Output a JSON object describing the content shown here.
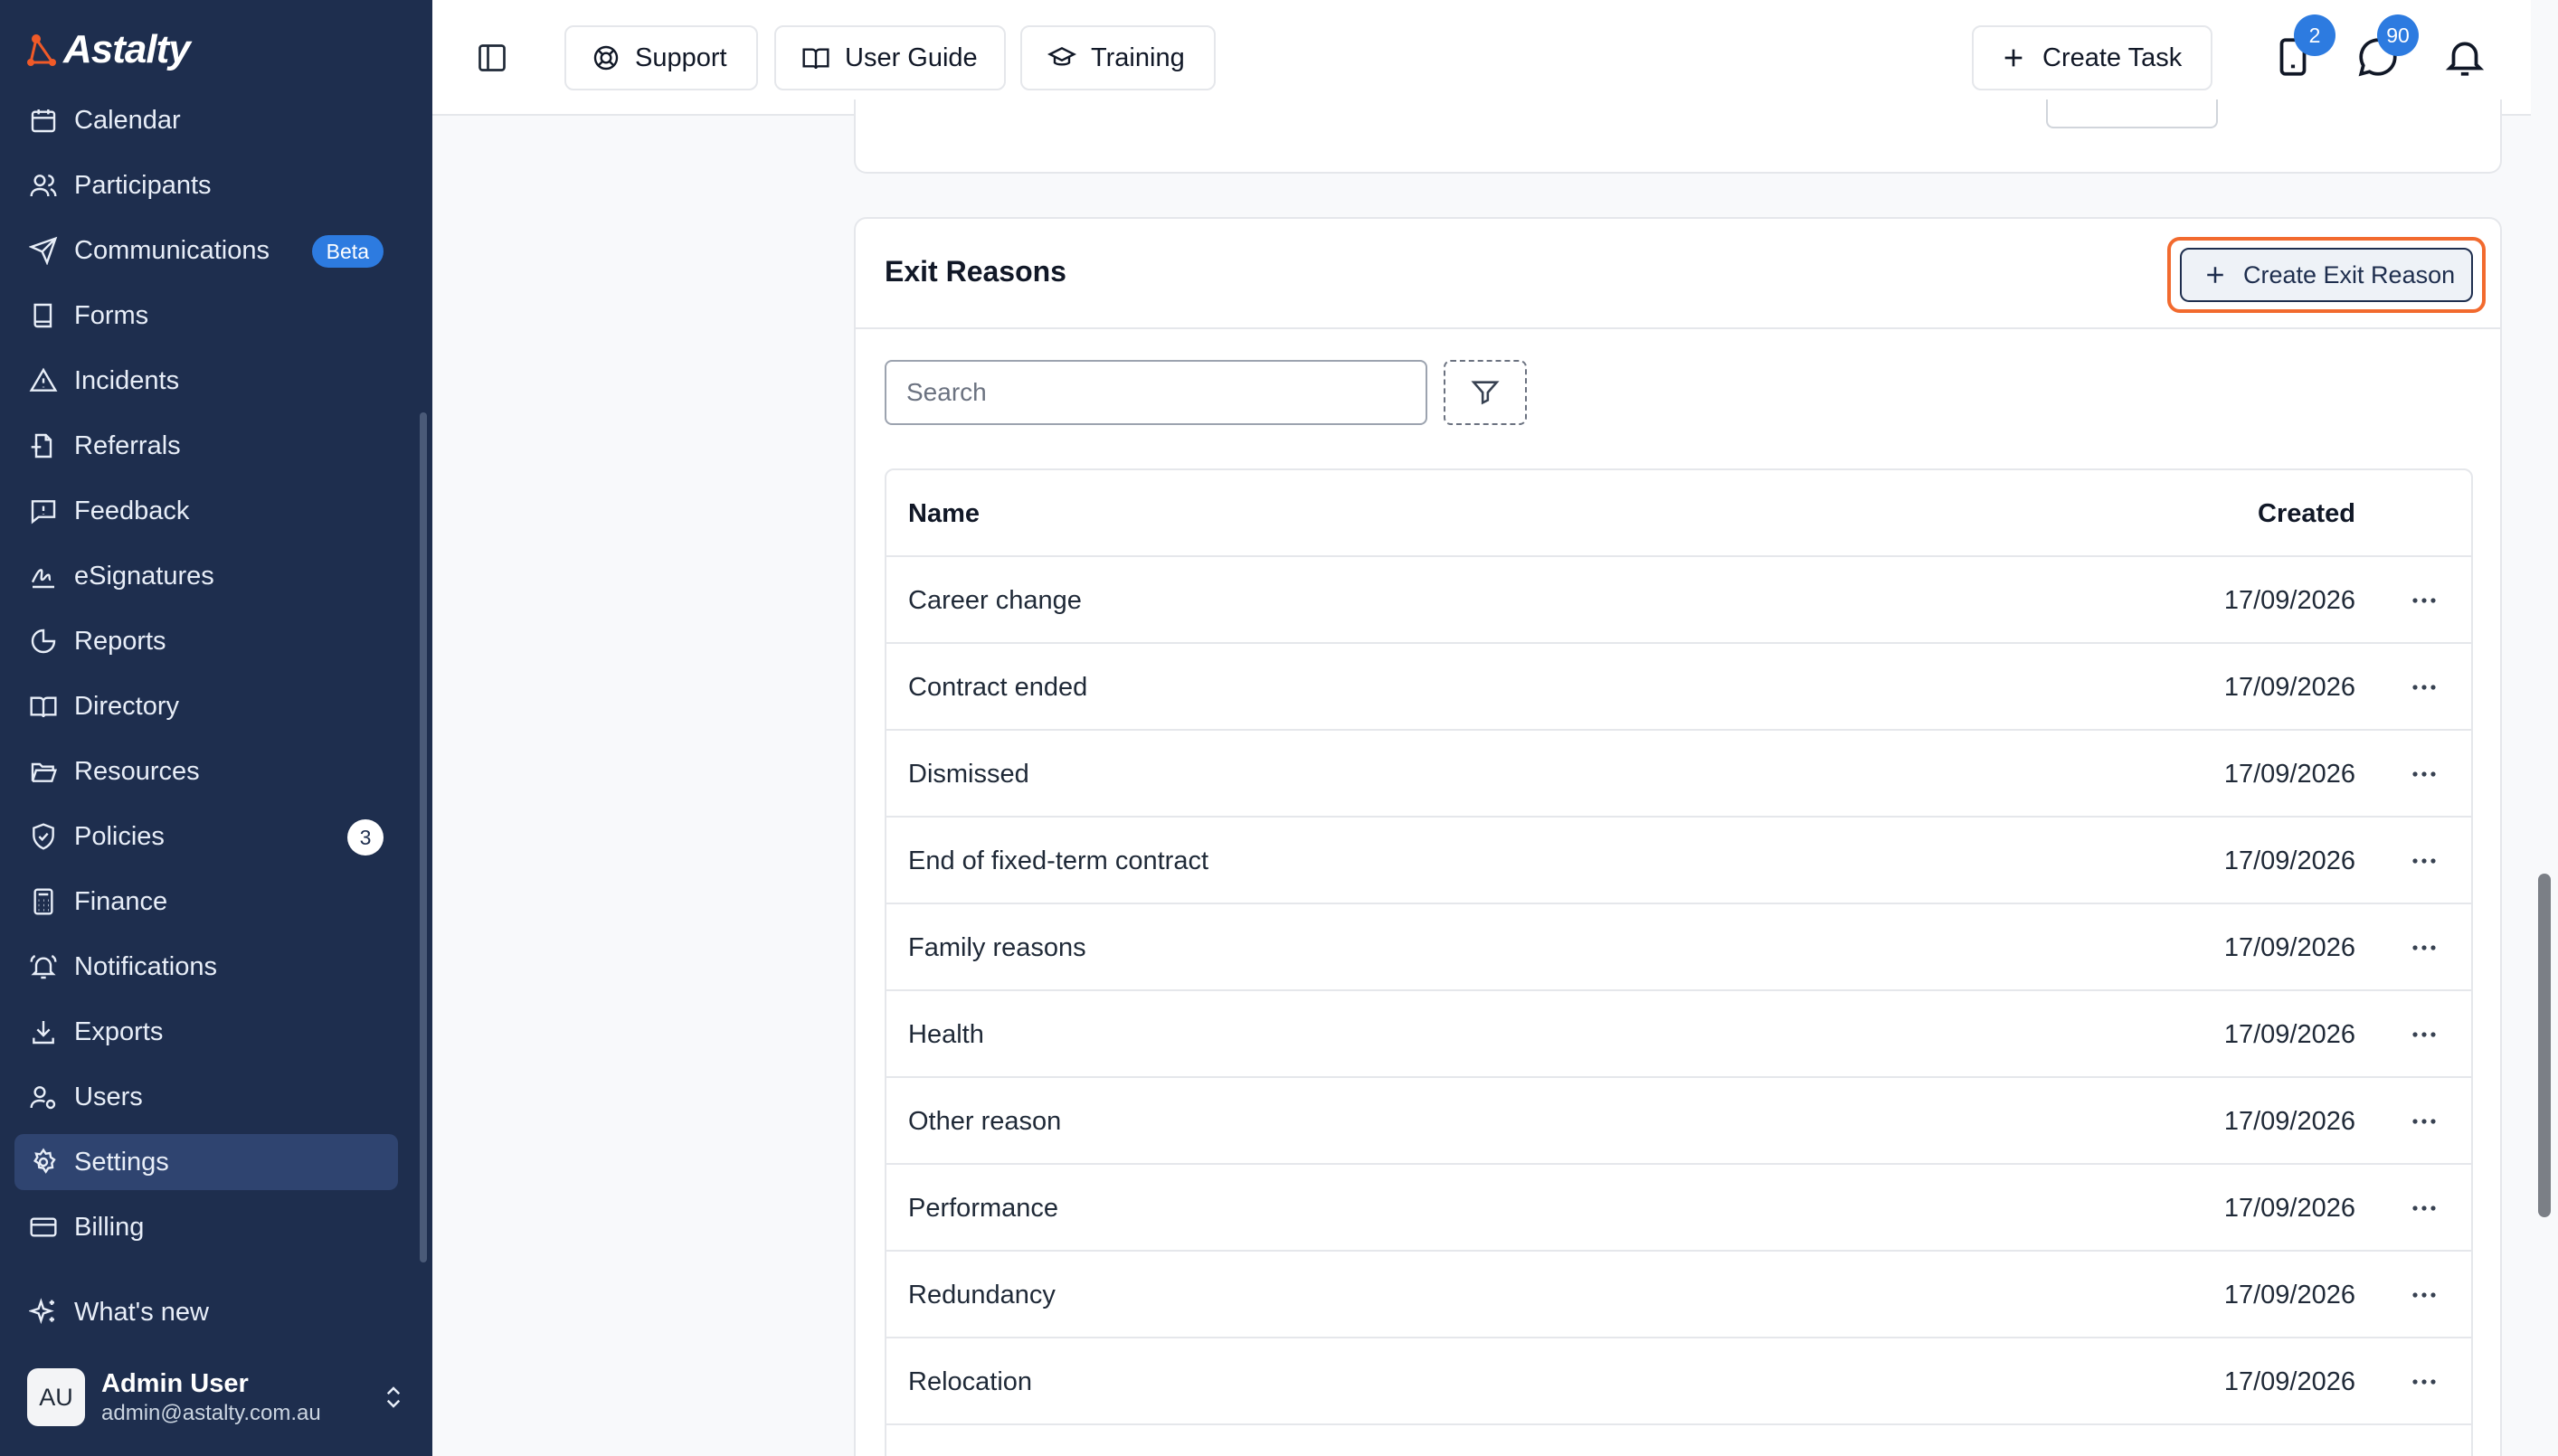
{
  "app": {
    "brand": "Astalty"
  },
  "sidebar": {
    "items": [
      {
        "label": "Calendar",
        "icon": "calendar-icon"
      },
      {
        "label": "Participants",
        "icon": "users-icon"
      },
      {
        "label": "Communications",
        "icon": "send-icon",
        "badge": "Beta"
      },
      {
        "label": "Forms",
        "icon": "book-icon"
      },
      {
        "label": "Incidents",
        "icon": "warning-icon"
      },
      {
        "label": "Referrals",
        "icon": "file-plus-icon"
      },
      {
        "label": "Feedback",
        "icon": "message-alert-icon"
      },
      {
        "label": "eSignatures",
        "icon": "signature-icon"
      },
      {
        "label": "Reports",
        "icon": "pie-chart-icon"
      },
      {
        "label": "Directory",
        "icon": "open-book-icon"
      },
      {
        "label": "Resources",
        "icon": "folder-open-icon"
      },
      {
        "label": "Policies",
        "icon": "shield-check-icon",
        "count": "3"
      },
      {
        "label": "Finance",
        "icon": "calculator-icon"
      },
      {
        "label": "Notifications",
        "icon": "bell-ring-icon"
      },
      {
        "label": "Exports",
        "icon": "download-icon"
      },
      {
        "label": "Users",
        "icon": "user-cog-icon"
      },
      {
        "label": "Settings",
        "icon": "gear-icon",
        "active": true
      },
      {
        "label": "Billing",
        "icon": "credit-card-icon"
      }
    ],
    "whats_new": "What's new",
    "user": {
      "initials": "AU",
      "name": "Admin User",
      "email": "admin@astalty.com.au"
    }
  },
  "header": {
    "support": "Support",
    "user_guide": "User Guide",
    "training": "Training",
    "create_task": "Create Task",
    "tasks_badge": "2",
    "messages_badge": "90"
  },
  "exit_reasons": {
    "title": "Exit Reasons",
    "create_label": "Create Exit Reason",
    "search_placeholder": "Search",
    "columns": {
      "name": "Name",
      "created": "Created"
    },
    "rows": [
      {
        "name": "Career change",
        "created": "17/09/2026"
      },
      {
        "name": "Contract ended",
        "created": "17/09/2026"
      },
      {
        "name": "Dismissed",
        "created": "17/09/2026"
      },
      {
        "name": "End of fixed-term contract",
        "created": "17/09/2026"
      },
      {
        "name": "Family reasons",
        "created": "17/09/2026"
      },
      {
        "name": "Health",
        "created": "17/09/2026"
      },
      {
        "name": "Other reason",
        "created": "17/09/2026"
      },
      {
        "name": "Performance",
        "created": "17/09/2026"
      },
      {
        "name": "Redundancy",
        "created": "17/09/2026"
      },
      {
        "name": "Relocation",
        "created": "17/09/2026"
      }
    ]
  },
  "colors": {
    "sidebar": "#1e2e4e",
    "accent": "#2d7be0",
    "highlight": "#f26a2e"
  }
}
